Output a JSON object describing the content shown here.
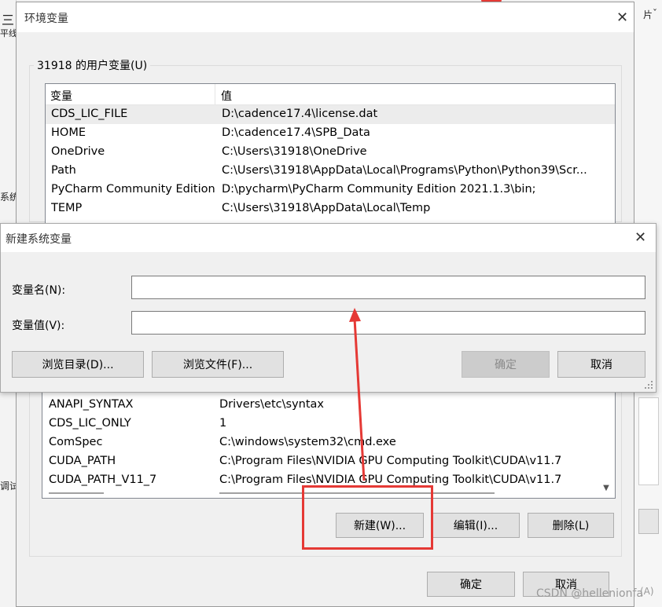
{
  "background_app": {
    "left_fragments": [
      "三",
      "平线",
      "系统",
      "调试"
    ],
    "right_fragments": [
      "片",
      "ˇ",
      "(A)"
    ]
  },
  "env_window": {
    "title": "环境变量",
    "user_vars": {
      "group_label": "31918 的用户变量(U)",
      "columns": [
        "变量",
        "值"
      ],
      "rows": [
        {
          "name": "CDS_LIC_FILE",
          "value": "D:\\cadence17.4\\license.dat"
        },
        {
          "name": "HOME",
          "value": "D:\\cadence17.4\\SPB_Data"
        },
        {
          "name": "OneDrive",
          "value": "C:\\Users\\31918\\OneDrive"
        },
        {
          "name": "Path",
          "value": "C:\\Users\\31918\\AppData\\Local\\Programs\\Python\\Python39\\Scr..."
        },
        {
          "name": "PyCharm Community Edition",
          "value": "D:\\pycharm\\PyCharm Community Edition 2021.1.3\\bin;"
        },
        {
          "name": "TEMP",
          "value": "C:\\Users\\31918\\AppData\\Local\\Temp"
        }
      ]
    },
    "system_vars": {
      "rows": [
        {
          "name": "ANAPI_SYNTAX",
          "value": "Drivers\\etc\\syntax"
        },
        {
          "name": "CDS_LIC_ONLY",
          "value": "1"
        },
        {
          "name": "ComSpec",
          "value": "C:\\windows\\system32\\cmd.exe"
        },
        {
          "name": "CUDA_PATH",
          "value": "C:\\Program Files\\NVIDIA GPU Computing Toolkit\\CUDA\\v11.7"
        },
        {
          "name": "CUDA_PATH_V11_7",
          "value": "C:\\Program Files\\NVIDIA GPU Computing Toolkit\\CUDA\\v11.7"
        }
      ],
      "buttons": {
        "new": "新建(W)...",
        "edit": "编辑(I)...",
        "delete": "删除(L)"
      }
    },
    "footer": {
      "ok": "确定",
      "cancel": "取消"
    }
  },
  "new_var_dialog": {
    "title": "新建系统变量",
    "name_label": "变量名(N):",
    "value_label": "变量值(V):",
    "name_value": "",
    "value_value": "",
    "browse_dir": "浏览目录(D)...",
    "browse_file": "浏览文件(F)...",
    "ok": "确定",
    "cancel": "取消"
  },
  "annotation": {
    "color": "#e53935"
  },
  "watermark": "CSDN @hellenionfa"
}
